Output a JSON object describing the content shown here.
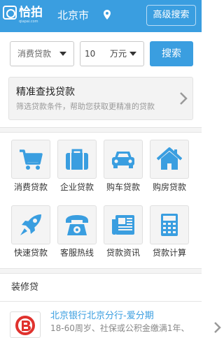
{
  "header": {
    "logo_text": "恰拍",
    "logo_sub": "qiapai.com",
    "city": "北京市",
    "advanced_search": "高级搜索"
  },
  "form": {
    "loan_type": "消费贷款",
    "amount": "10",
    "unit": "万元",
    "search_label": "搜索"
  },
  "precise": {
    "title": "精准查找贷款",
    "subtitle": "筛选贷款条件，帮助您获取更精准的贷款"
  },
  "categories": [
    {
      "label": "消费贷款",
      "icon": "shopping-cart-icon"
    },
    {
      "label": "企业贷款",
      "icon": "briefcase-icon"
    },
    {
      "label": "购车贷款",
      "icon": "car-icon"
    },
    {
      "label": "购房贷款",
      "icon": "house-icon"
    },
    {
      "label": "快速贷款",
      "icon": "rocket-icon"
    },
    {
      "label": "客服热线",
      "icon": "telephone-icon"
    },
    {
      "label": "贷款资讯",
      "icon": "newspaper-icon"
    },
    {
      "label": "贷款计算",
      "icon": "calculator-icon"
    }
  ],
  "section": {
    "title": "装修贷"
  },
  "loan_item": {
    "name": "北京银行北京分行-爱分期",
    "desc": "18-60周岁、社保或公积金缴满1年、"
  },
  "colors": {
    "brand_blue": "#3a9ee0",
    "icon_blue": "#3a9ee0",
    "bank_red": "#e0322e"
  }
}
